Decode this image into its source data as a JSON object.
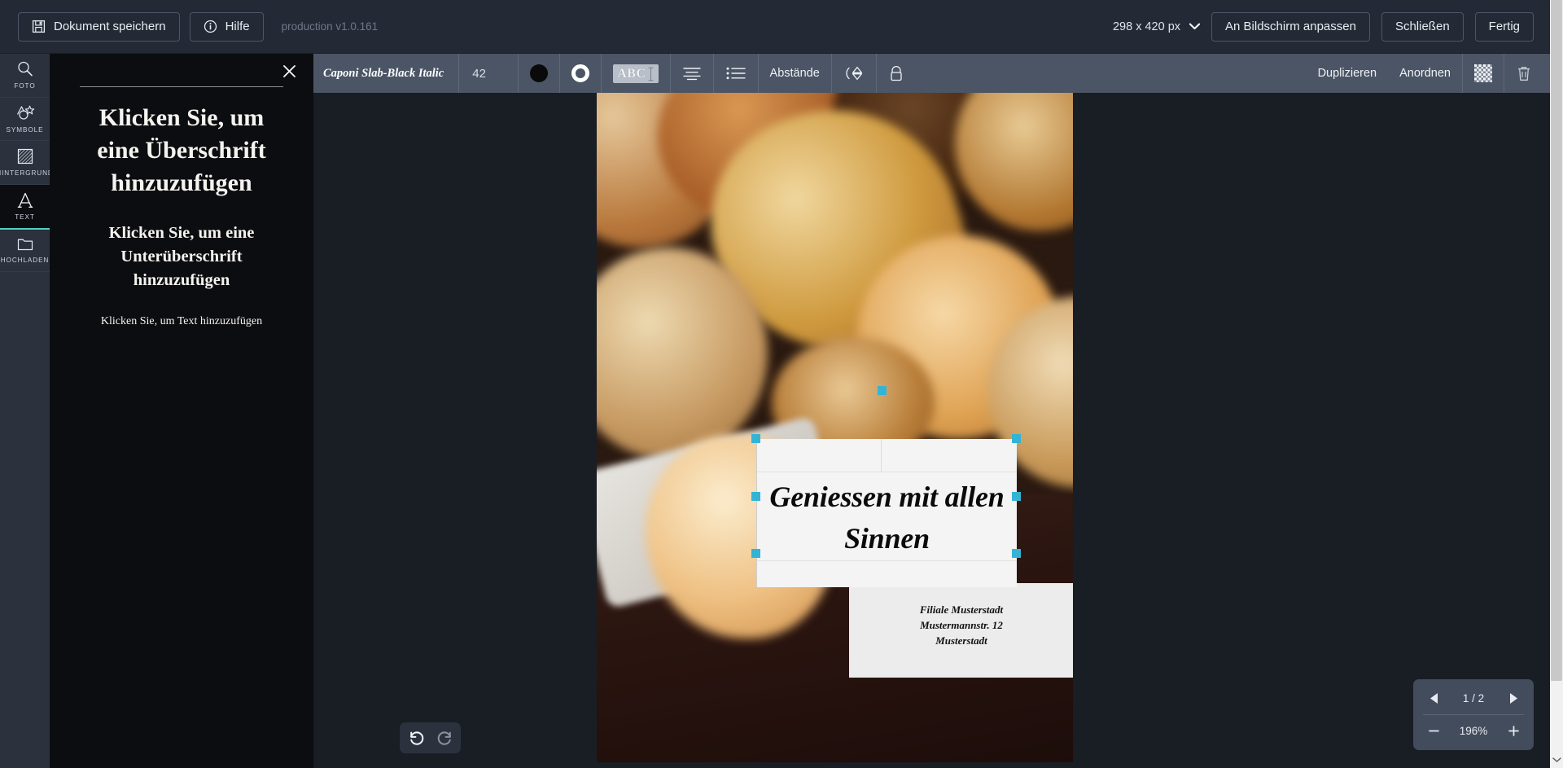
{
  "topbar": {
    "save_label": "Dokument speichern",
    "save_icon": "floppy-disk-icon",
    "help_label": "Hilfe",
    "help_icon": "info-circle-icon",
    "version": "production v1.0.161",
    "dimensions": "298 x 420 px",
    "dimensions_chevron": "chevron-down-icon",
    "fit_label": "An Bildschirm anpassen",
    "close_label": "Schließen",
    "done_label": "Fertig"
  },
  "rail": {
    "items": [
      {
        "label": "FOTO",
        "icon": "magnifier-icon",
        "active": false
      },
      {
        "label": "SYMBOLE",
        "icon": "shapes-star-icon",
        "active": false
      },
      {
        "label": "HINTERGRUND",
        "icon": "hatched-square-icon",
        "active": false
      },
      {
        "label": "TEXT",
        "icon": "letter-a-icon",
        "active": true
      },
      {
        "label": "HOCHLADEN",
        "icon": "folder-upload-icon",
        "active": false
      }
    ]
  },
  "panel": {
    "close_icon": "close-icon",
    "heading": "Klicken Sie, um eine Überschrift hinzuzufügen",
    "subheading": "Klicken Sie, um eine Unterüberschrift hinzuzufügen",
    "body": "Klicken Sie, um Text hinzuzufügen"
  },
  "formatbar": {
    "font_name": "Caponi Slab-Black Italic",
    "font_size": "42",
    "fill_color": "#0a0a0a",
    "outline_color": "#ffffff",
    "text_color_icon": "abc-text-color-icon",
    "text_color_label": "ABC",
    "align_icon": "align-center-icon",
    "list_icon": "bulleted-list-icon",
    "spacing_label": "Abstände",
    "flip_icon": "flip-vertical-icon",
    "lock_icon": "lock-icon",
    "duplicate_label": "Duplizieren",
    "arrange_label": "Anordnen",
    "transparency_icon": "checkerboard-transparency-icon",
    "delete_icon": "trash-icon"
  },
  "canvas": {
    "headline": "Geniessen mit allen Sinnen",
    "address_lines": [
      "Filiale Musterstadt",
      "Mustermannstr. 12",
      "Musterstadt"
    ],
    "selection_handle_color": "#34b4d4"
  },
  "history": {
    "undo_icon": "undo-arrow-icon",
    "redo_icon": "redo-arrow-icon"
  },
  "dock": {
    "prev_icon": "triangle-left-icon",
    "next_icon": "triangle-right-icon",
    "page_indicator": "1 / 2",
    "zoom_out_icon": "minus-icon",
    "zoom_in_icon": "plus-icon",
    "zoom_level": "196%"
  },
  "scrollbar": {
    "down_arrow_icon": "chevron-down-icon"
  }
}
